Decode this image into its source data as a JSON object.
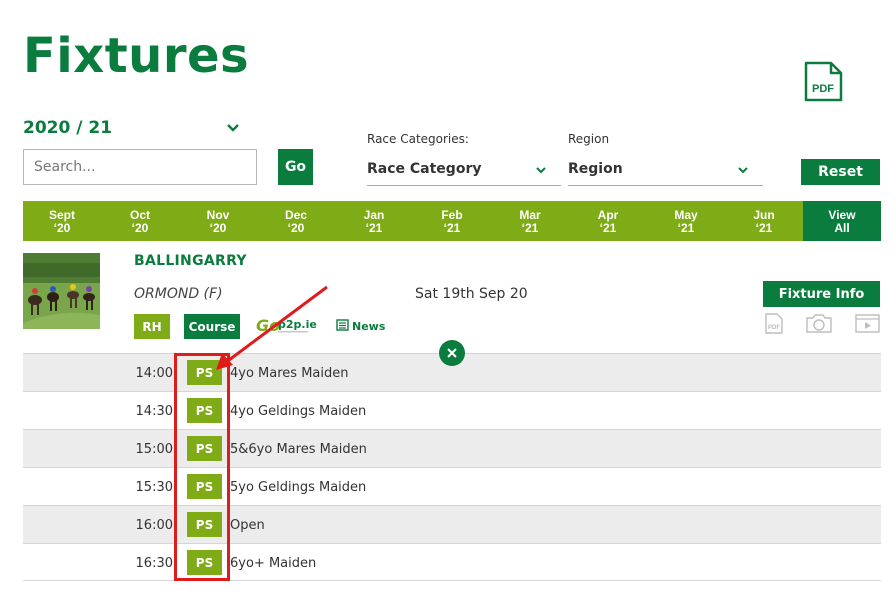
{
  "page": {
    "title": "Fixtures"
  },
  "toolbar": {
    "pdf_label": "PDF",
    "season": "2020 / 21",
    "search_placeholder": "Search...",
    "go_label": "Go",
    "reset_label": "Reset"
  },
  "filters": {
    "race_categories_label": "Race Categories:",
    "race_category_value": "Race Category",
    "region_label": "Region",
    "region_value": "Region"
  },
  "months": [
    {
      "line1": "Sept",
      "line2": "‘20"
    },
    {
      "line1": "Oct",
      "line2": "‘20"
    },
    {
      "line1": "Nov",
      "line2": "‘20"
    },
    {
      "line1": "Dec",
      "line2": "‘20"
    },
    {
      "line1": "Jan",
      "line2": "‘21"
    },
    {
      "line1": "Feb",
      "line2": "‘21"
    },
    {
      "line1": "Mar",
      "line2": "‘21"
    },
    {
      "line1": "Apr",
      "line2": "‘21"
    },
    {
      "line1": "May",
      "line2": "‘21"
    },
    {
      "line1": "Jun",
      "line2": "‘21"
    },
    {
      "line1": "View",
      "line2": "All"
    }
  ],
  "fixture": {
    "course": "BALLINGARRY",
    "meeting": "ORMOND (F)",
    "date": "Sat 19th Sep 20",
    "tag_rh": "RH",
    "tag_course": "Course",
    "go_logo_text": "p2p.ie",
    "news_label": "News",
    "fixture_info_label": "Fixture Info"
  },
  "races": [
    {
      "time": "14:00",
      "badge": "PS",
      "title": "4yo Mares Maiden"
    },
    {
      "time": "14:30",
      "badge": "PS",
      "title": "4yo Geldings Maiden"
    },
    {
      "time": "15:00",
      "badge": "PS",
      "title": "5&6yo Mares Maiden"
    },
    {
      "time": "15:30",
      "badge": "PS",
      "title": "5yo Geldings Maiden"
    },
    {
      "time": "16:00",
      "badge": "PS",
      "title": "Open"
    },
    {
      "time": "16:30",
      "badge": "PS",
      "title": "6yo+ Maiden"
    }
  ],
  "colors": {
    "brand_green": "#0a7c3e",
    "light_green": "#7fab17",
    "annotation_red": "#e01b1b"
  }
}
